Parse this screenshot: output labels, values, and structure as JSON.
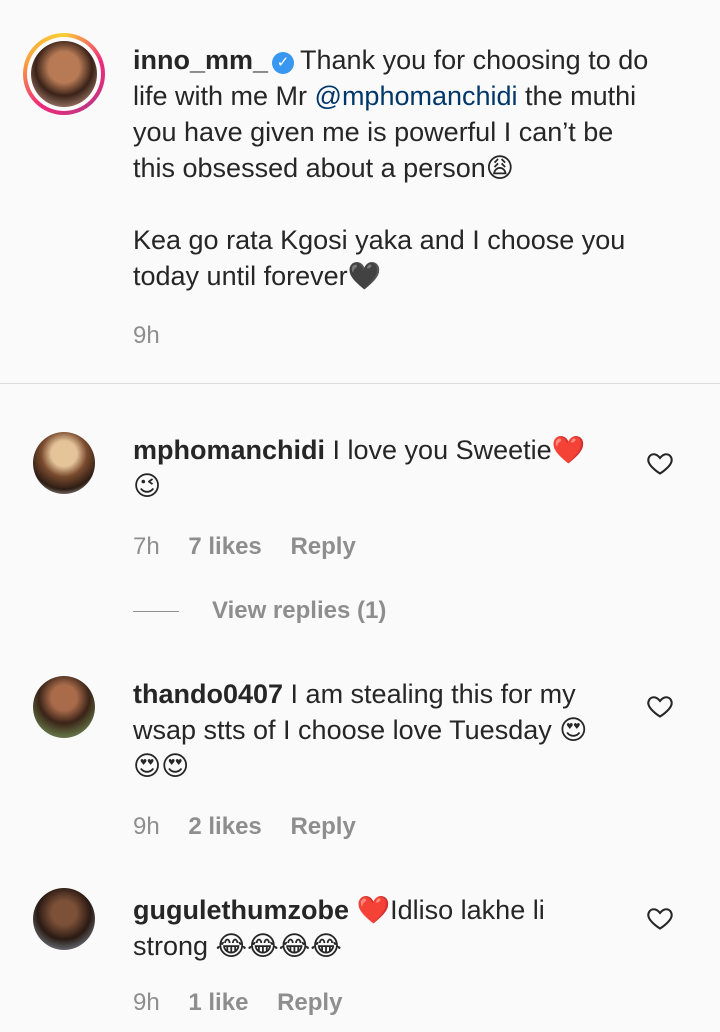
{
  "post": {
    "username": "inno_mm_",
    "caption_part1": "Thank you for choosing to do",
    "caption_line2_a": "life with me Mr ",
    "mention": "@mphomanchidi",
    "caption_line2_b": " the muthi",
    "caption_line3": "you have given me is powerful I can’t be",
    "caption_line4": "this obsessed about a person",
    "emoji_weary": "😩",
    "caption_line5": "Kea go rata Kgosi yaka and I choose you",
    "caption_line6": "today until forever",
    "emoji_black_heart": "🖤",
    "time": "9h"
  },
  "comments": [
    {
      "username": "mphomanchidi",
      "text": " I love you Sweetie",
      "emoji_a": "❤️",
      "emoji_b": "😉",
      "time": "7h",
      "likes": "7 likes",
      "reply": "Reply",
      "view_replies": "View replies (1)"
    },
    {
      "username": "thando0407",
      "text_line1": " I am stealing this for my",
      "text_line2": "wsap stts of I choose love Tuesday ",
      "emoji_line2": "😍",
      "emoji_line3": "😍😍",
      "time": "9h",
      "likes": "2 likes",
      "reply": "Reply"
    },
    {
      "username": "gugulethumzobe",
      "emoji_heart": "❤️",
      "text_line1": "Idliso lakhe li",
      "text_line2": "strong ",
      "emoji_line2": "😂😂😂😂",
      "time": "9h",
      "likes": "1 like",
      "reply": "Reply"
    }
  ],
  "icons": {
    "verified": "verified-badge-icon",
    "like": "heart-outline-icon"
  },
  "colors": {
    "mention": "#00376b",
    "verified": "#3897f0",
    "muted": "#8e8e8e"
  }
}
